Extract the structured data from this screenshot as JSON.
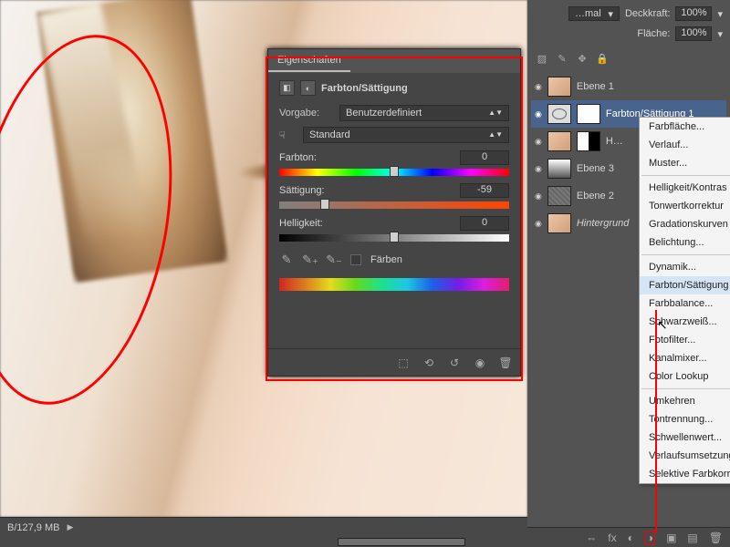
{
  "panel": {
    "tab": "Eigenschaften",
    "title": "Farbton/Sättigung",
    "preset_label": "Vorgabe:",
    "preset_value": "Benutzerdefiniert",
    "range_value": "Standard",
    "hue_label": "Farbton:",
    "hue_value": "0",
    "sat_label": "Sättigung:",
    "sat_value": "-59",
    "light_label": "Helligkeit:",
    "light_value": "0",
    "colorize_label": "Färben"
  },
  "status": {
    "doc_info": "B/127,9 MB",
    "play": "▶"
  },
  "options": {
    "blend_mode": "…mal",
    "opacity_label": "Deckkraft:",
    "opacity_value": "100%",
    "fill_label": "Fläche:",
    "fill_value": "100%"
  },
  "layers": [
    {
      "name": "Ebene 1",
      "kind": "face"
    },
    {
      "name": "Farbton/Sättigung 1",
      "kind": "adj",
      "selected": true
    },
    {
      "name": "H…",
      "kind": "masked"
    },
    {
      "name": "Ebene 3",
      "kind": "grad"
    },
    {
      "name": "Ebene 2",
      "kind": "tex"
    },
    {
      "name": "Hintergrund",
      "kind": "face",
      "bg": true
    }
  ],
  "menu": {
    "items": [
      "Farbfläche...",
      "Verlauf...",
      "Muster...",
      "-",
      "Helligkeit/Kontras",
      "Tonwertkorrektur",
      "Gradationskurven",
      "Belichtung...",
      "-",
      "Dynamik...",
      "Farbton/Sättigung",
      "Farbbalance...",
      "Schwarzweiß...",
      "Fotofilter...",
      "Kanalmixer...",
      "Color Lookup",
      "-",
      "Umkehren",
      "Tontrennung...",
      "Schwellenwert...",
      "Verlaufsumsetzung",
      "Selektive Farbkorr"
    ],
    "highlighted": "Farbton/Sättigung"
  }
}
